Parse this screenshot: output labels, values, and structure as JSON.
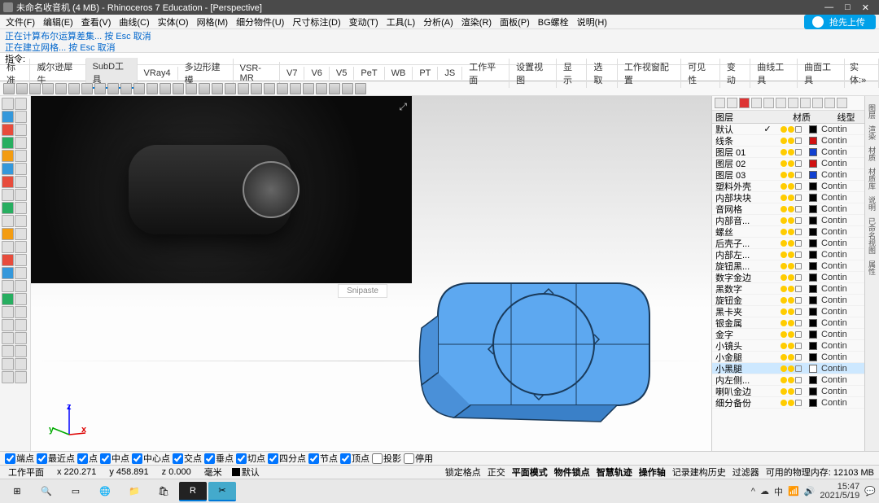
{
  "title": "未命名收音机 (4 MB) - Rhinoceros 7 Education - [Perspective]",
  "window_controls": {
    "min": "—",
    "max": "□",
    "close": "✕"
  },
  "menu": [
    "文件(F)",
    "编辑(E)",
    "查看(V)",
    "曲线(C)",
    "实体(O)",
    "网格(M)",
    "细分物件(U)",
    "尺寸标注(D)",
    "变动(T)",
    "工具(L)",
    "分析(A)",
    "渲染(R)",
    "面板(P)",
    "BG螺栓",
    "说明(H)"
  ],
  "cloud_btn": "抢先上传",
  "status1": "正在计算布尔运算差集... 按 Esc 取消",
  "status2": "正在建立网格... 按 Esc 取消",
  "cmd_label": "指令:",
  "tabs": [
    "标准",
    "威尔逊犀牛",
    "SubD工具",
    "VRay4",
    "多边形建模",
    "VSR-MR",
    "V7",
    "V6",
    "V5",
    "PeT",
    "WB",
    "PT",
    "JS",
    "工作平面",
    "设置视图",
    "显示",
    "选取",
    "工作视窗配置",
    "可见性",
    "变动",
    "曲线工具",
    "曲面工具"
  ],
  "tabs_more": "实体:»",
  "active_tab": 2,
  "ref_label": "Snipaste",
  "layer_header": {
    "c1": "图层",
    "c2": "材质",
    "c3": "线型"
  },
  "layers": [
    {
      "n": "默认",
      "chk": "✓",
      "c": "#000000",
      "lt": "Contin"
    },
    {
      "n": "线条",
      "c": "#d01010",
      "lt": "Contin"
    },
    {
      "n": "图层 01",
      "c": "#1040d0",
      "lt": "Contin"
    },
    {
      "n": "图层 02",
      "c": "#d01010",
      "lt": "Contin"
    },
    {
      "n": "图层 03",
      "c": "#1040d0",
      "lt": "Contin"
    },
    {
      "n": "塑料外壳",
      "c": "#000000",
      "lt": "Contin"
    },
    {
      "n": "内部块块",
      "c": "#000000",
      "lt": "Contin"
    },
    {
      "n": "音网格",
      "c": "#000000",
      "lt": "Contin"
    },
    {
      "n": "内部音...",
      "c": "#000000",
      "lt": "Contin"
    },
    {
      "n": "螺丝",
      "c": "#000000",
      "lt": "Contin"
    },
    {
      "n": "后壳子...",
      "c": "#000000",
      "lt": "Contin"
    },
    {
      "n": "内部左...",
      "c": "#000000",
      "lt": "Contin"
    },
    {
      "n": "旋钮黑...",
      "c": "#000000",
      "lt": "Contin"
    },
    {
      "n": "数字金边",
      "c": "#000000",
      "lt": "Contin"
    },
    {
      "n": "黑数字",
      "c": "#000000",
      "lt": "Contin"
    },
    {
      "n": "旋钮金",
      "c": "#000000",
      "lt": "Contin"
    },
    {
      "n": "黑卡夹",
      "c": "#000000",
      "lt": "Contin"
    },
    {
      "n": "银金属",
      "c": "#000000",
      "lt": "Contin"
    },
    {
      "n": "金字",
      "c": "#000000",
      "lt": "Contin"
    },
    {
      "n": "小镜头",
      "c": "#000000",
      "lt": "Contin"
    },
    {
      "n": "小金腿",
      "c": "#000000",
      "lt": "Contin"
    },
    {
      "n": "小黑腿",
      "c": "#ffffff",
      "lt": "Contin",
      "sel": true
    },
    {
      "n": "内左侧...",
      "c": "#000000",
      "lt": "Contin"
    },
    {
      "n": "喇叭金边",
      "c": "#000000",
      "lt": "Contin"
    },
    {
      "n": "细分备份",
      "c": "#000000",
      "lt": "Contin"
    }
  ],
  "osnap": [
    "端点",
    "最近点",
    "点",
    "中点",
    "中心点",
    "交点",
    "垂点",
    "切点",
    "四分点",
    "节点",
    "顶点",
    "投影",
    "停用"
  ],
  "osnap_checked": [
    true,
    true,
    true,
    true,
    true,
    true,
    true,
    true,
    true,
    true,
    true,
    false,
    false
  ],
  "statusbar": {
    "cplane": "工作平面",
    "x": "x 220.271",
    "y": "y 458.891",
    "z": "z 0.000",
    "unit": "毫米",
    "layer": "默认",
    "items": [
      "锁定格点",
      "正交",
      "平面模式",
      "物件锁点",
      "智慧轨迹",
      "操作轴",
      "记录建构历史",
      "过滤器",
      "可用的物理内存: 12103 MB"
    ]
  },
  "side_labels": [
    "图层",
    "渲染",
    "材质",
    "材质库",
    "说明",
    "已命名视图",
    "属性"
  ],
  "time": "15:47",
  "date": "2021/5/19",
  "axis": {
    "x": "x",
    "y": "y",
    "z": "z"
  }
}
